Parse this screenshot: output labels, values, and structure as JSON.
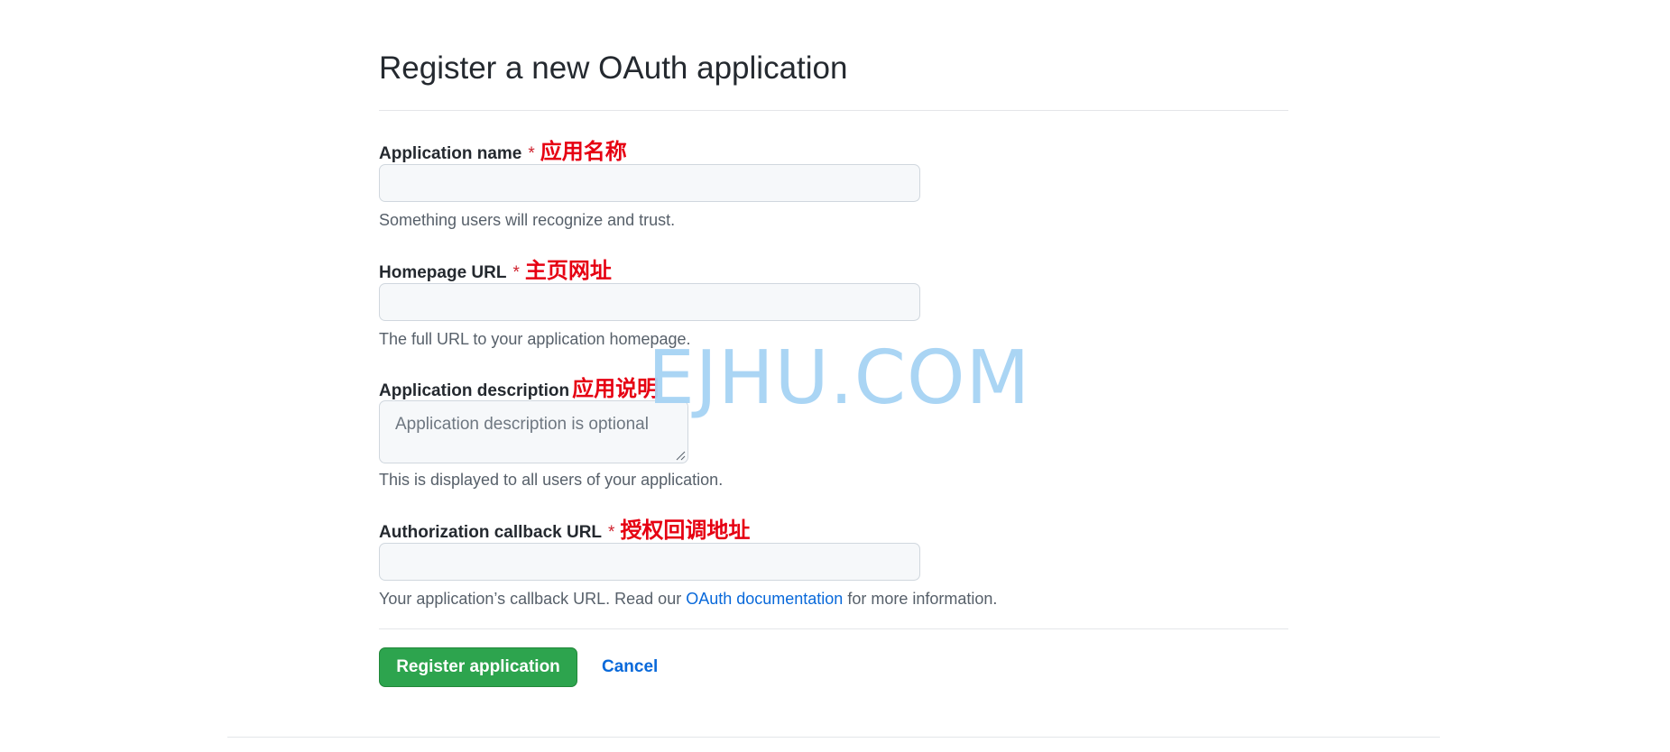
{
  "page": {
    "title": "Register a new OAuth application"
  },
  "form": {
    "app_name": {
      "label": "Application name",
      "required_mark": "*",
      "annotation": "应用名称",
      "value": "",
      "hint": "Something users will recognize and trust."
    },
    "homepage_url": {
      "label": "Homepage URL",
      "required_mark": "*",
      "annotation": "主页网址",
      "value": "",
      "hint": "The full URL to your application homepage."
    },
    "description": {
      "label": "Application description",
      "annotation": "应用说明",
      "placeholder": "Application description is optional",
      "hint": "This is displayed to all users of your application."
    },
    "callback_url": {
      "label": "Authorization callback URL",
      "required_mark": "*",
      "annotation": "授权回调地址",
      "value": "",
      "hint_before": "Your application’s callback URL. Read our ",
      "hint_link": "OAuth documentation",
      "hint_after": " for more information."
    }
  },
  "actions": {
    "register_label": "Register application",
    "cancel_label": "Cancel"
  },
  "watermark": "EJHU.COM",
  "colors": {
    "primary_button": "#2da44e",
    "link": "#0969da",
    "required": "#cf222e",
    "annotation": "#e60012",
    "watermark": "#a6d3f4"
  }
}
